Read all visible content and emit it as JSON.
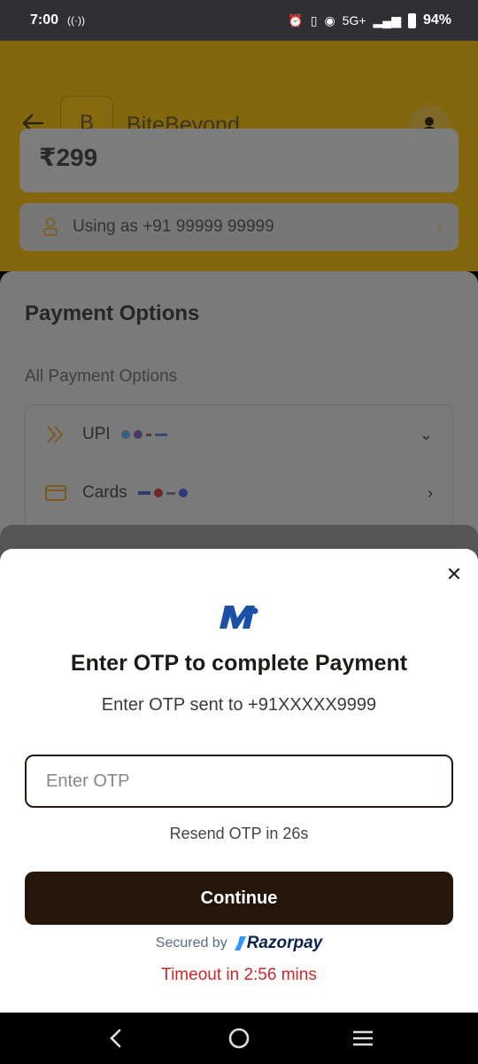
{
  "status_bar": {
    "time": "7:00",
    "network": "5G+",
    "battery": "94%"
  },
  "header": {
    "logo_letter": "B",
    "brand_name": "BiteBeyond"
  },
  "order": {
    "amount": "₹299",
    "using_as": "Using as +91 99999 99999"
  },
  "payment_options": {
    "title": "Payment Options",
    "subtitle": "All Payment Options",
    "items": [
      {
        "label": "UPI",
        "icon": "upi-icon"
      },
      {
        "label": "Cards",
        "icon": "card-icon"
      }
    ]
  },
  "otp_sheet": {
    "title": "Enter OTP to complete Payment",
    "subtitle": "Enter OTP sent to +91XXXXX9999",
    "input_placeholder": "Enter OTP",
    "resend_text": "Resend OTP in 26s",
    "continue_label": "Continue",
    "secured_by": "Secured by",
    "provider": "Razorpay",
    "timeout_text": "Timeout in 2:56 mins"
  },
  "colors": {
    "brand_dimmed": "#83670f",
    "button_dark": "#24160b",
    "timeout_red": "#d0262b"
  }
}
